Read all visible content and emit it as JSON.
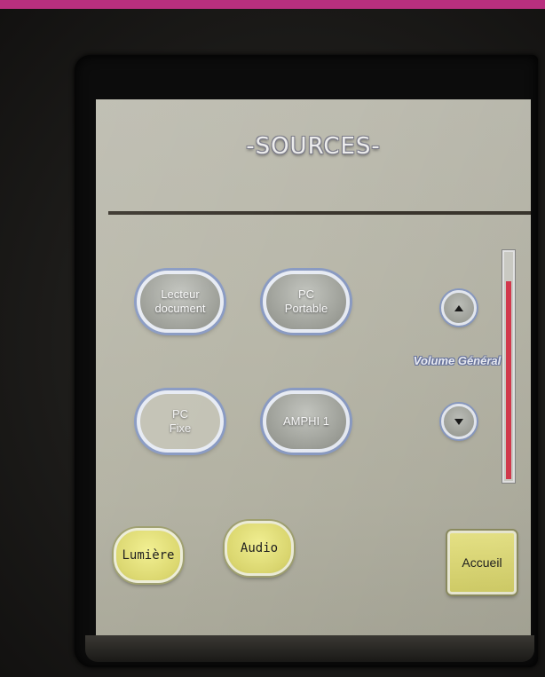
{
  "screen": {
    "title": "-SOURCES-",
    "sources": [
      {
        "label_line1": "Lecteur",
        "label_line2": "document"
      },
      {
        "label_line1": "PC",
        "label_line2": "Portable"
      },
      {
        "label_line1": "PC",
        "label_line2": "Fixe"
      },
      {
        "label_line1": "AMPHI 1",
        "label_line2": ""
      }
    ],
    "volume": {
      "label": "Volume Général",
      "level_fraction": 0.88,
      "up_icon": "arrow-up-icon",
      "down_icon": "arrow-down-icon"
    },
    "bottom": {
      "lumiere_label": "Lumière",
      "audio_label": "Audio",
      "accueil_label": "Accueil"
    }
  },
  "colors": {
    "top_bar": "#b82f7e",
    "screen_bg": "#bbbaac",
    "yellow_button": "#e4e07a",
    "volume_fill": "#d83a4e"
  }
}
